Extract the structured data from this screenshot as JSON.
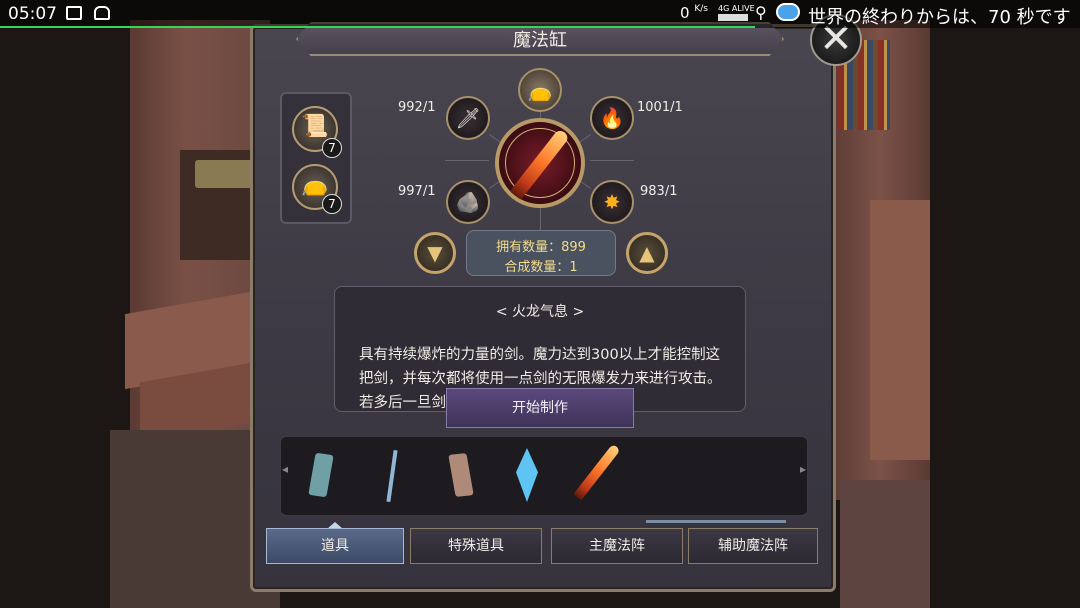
{
  "status_bar": {
    "time": "05:07",
    "network_speed_value": "0",
    "network_speed_unit": "K/s",
    "network_type": "4G ALIVE",
    "message": "世界の終わりからは、70 秒です"
  },
  "dialog": {
    "title": "魔法缸",
    "close_icon": "✕"
  },
  "inventory": [
    {
      "icon": "scroll-book-icon",
      "glyph": "📜",
      "count": "7"
    },
    {
      "icon": "pouch-icon",
      "glyph": "👝",
      "count": "7"
    }
  ],
  "recipe": {
    "ingredients": [
      {
        "name": "sword-material-icon",
        "glyph": "🗡",
        "requirement": "992/1"
      },
      {
        "name": "crystal-shard-icon",
        "glyph": "🔥",
        "requirement": "1001/1"
      },
      {
        "name": "dark-stone-icon",
        "glyph": "🪨",
        "requirement": "997/1"
      },
      {
        "name": "fire-ore-icon",
        "glyph": "✸",
        "requirement": "983/1"
      }
    ],
    "top_ingredient_icon": "pouch-icon",
    "result_icon": "fire-dragon-sword-icon",
    "owned_label": "拥有数量：899",
    "craft_label": "合成数量：1",
    "decrease_icon": "chevron-down-icon",
    "increase_icon": "chevron-up-icon"
  },
  "description": {
    "title": "< 火龙气息 >",
    "body": "具有持续爆炸的力量的剑。魔力达到300以上才能控制这把剑，并每次都将使用一点剑的无限爆发力来进行攻击。若多后一旦剑中燃尽，则会复活一轮将"
  },
  "start_button": "开始制作",
  "materials": [
    {
      "name": "blue-shard-icon",
      "color": "#6fa0a6"
    },
    {
      "name": "ice-wand-icon",
      "color": "#8fb6d6"
    },
    {
      "name": "stone-fragment-icon",
      "color": "#b08a78"
    },
    {
      "name": "blue-crystal-icon",
      "color": "#5ec4f4"
    },
    {
      "name": "fire-sword-icon",
      "color": "#ff8a3a"
    }
  ],
  "tabs": [
    {
      "label": "道具",
      "active": true
    },
    {
      "label": "特殊道具",
      "active": false
    },
    {
      "label": "主魔法阵",
      "active": false
    },
    {
      "label": "辅助魔法阵",
      "active": false
    }
  ]
}
